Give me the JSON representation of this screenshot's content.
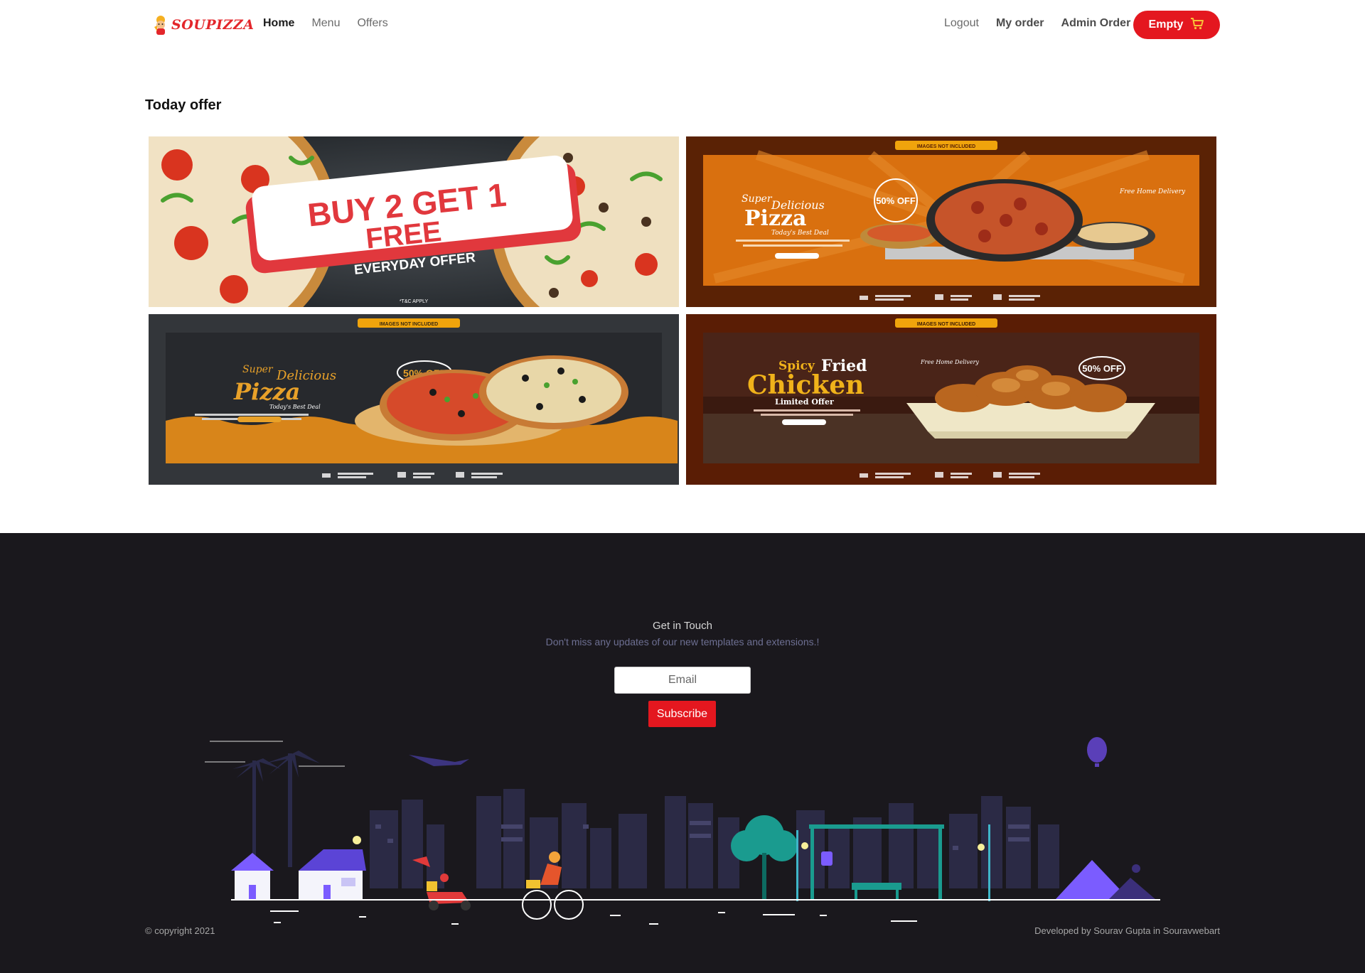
{
  "brand": {
    "name": "SOUPIZZA",
    "color": "#e3262b"
  },
  "nav": {
    "left": [
      {
        "label": "Home",
        "active": true
      },
      {
        "label": "Menu",
        "active": false
      },
      {
        "label": "Offers",
        "active": false
      }
    ],
    "right": [
      {
        "label": "Logout"
      },
      {
        "label": "My order"
      },
      {
        "label": "Admin Order"
      }
    ],
    "cart_label": "Empty",
    "cart_icon": "cart-icon",
    "accent": "#e4171f"
  },
  "offers": {
    "title": "Today offer",
    "cards": [
      {
        "line1": "BUY 2 GET 1",
        "line2": "FREE",
        "line3": "EVERYDAY OFFER",
        "note": "*T&C APPLY"
      },
      {
        "badge": "IMAGES NOT INCLUDED",
        "pre": "Super",
        "mid": "Delicious",
        "big": "Pizza",
        "tag": "Today's Best Deal",
        "discount": "50% OFF",
        "side": "Free Home Delivery"
      },
      {
        "badge": "IMAGES NOT INCLUDED",
        "pre": "Super",
        "mid": "Delicious",
        "big": "Pizza",
        "tag": "Today's Best Deal",
        "discount": "50% OFF"
      },
      {
        "badge": "IMAGES NOT INCLUDED",
        "pre": "Spicy",
        "mid": "Fried",
        "big": "Chicken",
        "tag": "Limited Offer",
        "discount": "50% OFF",
        "side": "Free Home Delivery"
      }
    ]
  },
  "footer": {
    "title": "Get in Touch",
    "subtitle": "Don't miss any updates of our new templates and extensions.!",
    "email_placeholder": "Email",
    "subscribe_label": "Subscribe",
    "copyright": "© copyright 2021",
    "developer": "Developed by Sourav Gupta in Souravwebart",
    "bg": "#1a181d"
  }
}
